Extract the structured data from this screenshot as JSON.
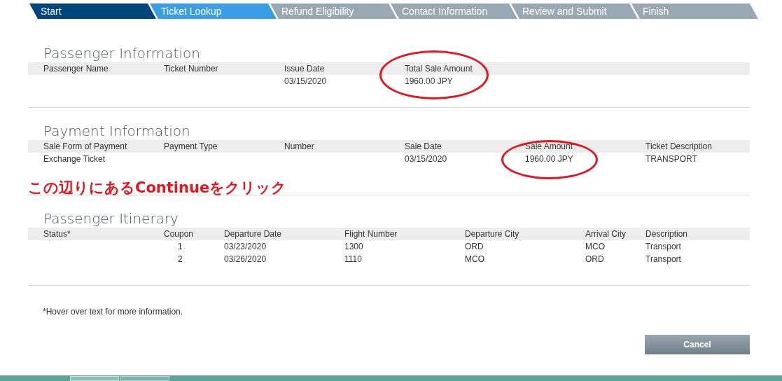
{
  "steps": [
    {
      "label": "Start",
      "completed": true,
      "selected": false
    },
    {
      "label": "Ticket Lookup",
      "completed": false,
      "selected": true
    },
    {
      "label": "Refund Eligibility",
      "completed": false,
      "selected": false
    },
    {
      "label": "Contact Information",
      "completed": false,
      "selected": false
    },
    {
      "label": "Review and Submit",
      "completed": false,
      "selected": false
    },
    {
      "label": "Finish",
      "completed": false,
      "selected": false
    }
  ],
  "sections": [
    {
      "title": "Passenger Information",
      "columns": [
        "Passenger Name",
        "Ticket Number",
        "Issue Date",
        "Total Sale Amount"
      ],
      "rows": [
        [
          "",
          "",
          "03/15/2020",
          "1960.00 JPY"
        ]
      ]
    },
    {
      "title": "Payment Information",
      "columns": [
        "Sale Form of Payment",
        "Payment Type",
        "Number",
        "Sale Date",
        "Sale Amount",
        "Ticket Description"
      ],
      "rows": [
        [
          "Exchange Ticket",
          "",
          "",
          "03/15/2020",
          "1960.00 JPY",
          "TRANSPORT"
        ]
      ]
    },
    {
      "title": "Passenger Itinerary",
      "columns": [
        "Status*",
        "Coupon",
        "Departure Date",
        "Flight Number",
        "Departure City",
        "Arrival City",
        "Description"
      ],
      "rows": [
        [
          "",
          "1",
          "03/23/2020",
          "1300",
          "ORD",
          "MCO",
          "Transport"
        ],
        [
          "",
          "2",
          "03/26/2020",
          "1110",
          "MCO",
          "ORD",
          "Transport"
        ]
      ]
    }
  ],
  "footnote": "*Hover over text for more information.",
  "cancel_button": "Cancel",
  "annotation": "この辺りにあるContinueをクリック"
}
